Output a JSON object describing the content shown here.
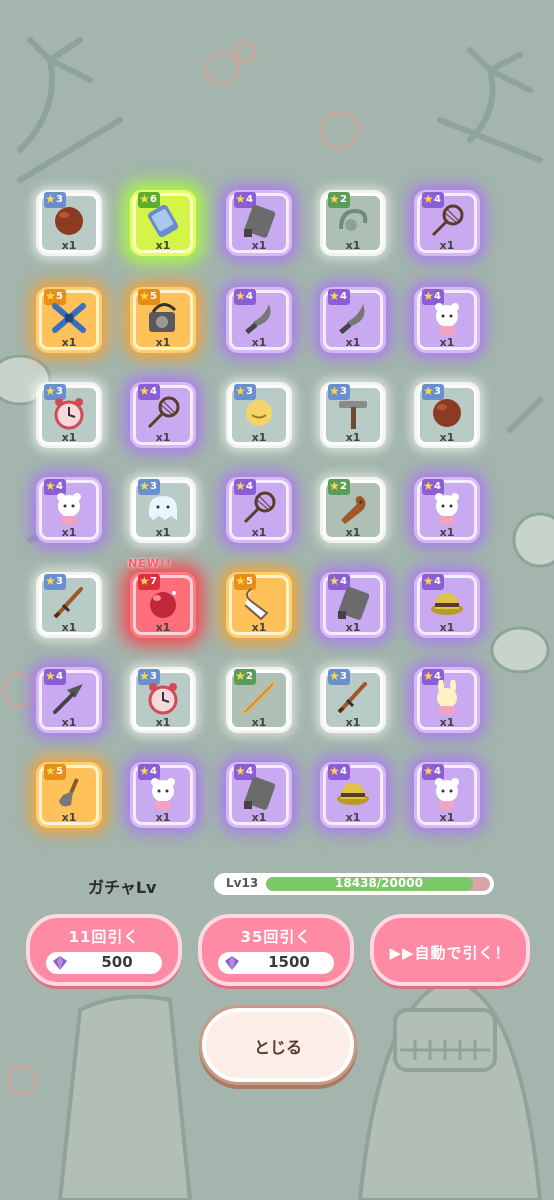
{
  "items": [
    {
      "stars": "3",
      "count": "x1",
      "rarity": "r3",
      "icon": "ball-icon"
    },
    {
      "stars": "6",
      "count": "x1",
      "rarity": "r6",
      "icon": "phone-icon"
    },
    {
      "stars": "4",
      "count": "x1",
      "rarity": "r4",
      "icon": "tablet-icon"
    },
    {
      "stars": "2",
      "count": "x1",
      "rarity": "r2",
      "icon": "hook-icon"
    },
    {
      "stars": "4",
      "count": "x1",
      "rarity": "r4",
      "icon": "net-icon"
    },
    {
      "stars": "5",
      "count": "x1",
      "rarity": "r5",
      "icon": "ninja-icon"
    },
    {
      "stars": "5",
      "count": "x1",
      "rarity": "r5",
      "icon": "camera-icon"
    },
    {
      "stars": "4",
      "count": "x1",
      "rarity": "r4",
      "icon": "knife-icon"
    },
    {
      "stars": "4",
      "count": "x1",
      "rarity": "r4",
      "icon": "knife-icon"
    },
    {
      "stars": "4",
      "count": "x1",
      "rarity": "r4",
      "icon": "bear-icon"
    },
    {
      "stars": "3",
      "count": "x1",
      "rarity": "r3",
      "icon": "clock-icon"
    },
    {
      "stars": "4",
      "count": "x1",
      "rarity": "r4",
      "icon": "net-icon"
    },
    {
      "stars": "3",
      "count": "x1",
      "rarity": "r3",
      "icon": "coin-icon"
    },
    {
      "stars": "3",
      "count": "x1",
      "rarity": "r3",
      "icon": "mop-icon"
    },
    {
      "stars": "3",
      "count": "x1",
      "rarity": "r3",
      "icon": "ball-icon"
    },
    {
      "stars": "4",
      "count": "x1",
      "rarity": "r4",
      "icon": "bear-icon"
    },
    {
      "stars": "3",
      "count": "x1",
      "rarity": "r3",
      "icon": "ghost-icon"
    },
    {
      "stars": "4",
      "count": "x1",
      "rarity": "r4",
      "icon": "net-icon"
    },
    {
      "stars": "2",
      "count": "x1",
      "rarity": "r2",
      "icon": "club-icon"
    },
    {
      "stars": "4",
      "count": "x1",
      "rarity": "r4",
      "icon": "bear-icon"
    },
    {
      "stars": "3",
      "count": "x1",
      "rarity": "r3",
      "icon": "sword-icon"
    },
    {
      "stars": "7",
      "count": "x1",
      "rarity": "r7",
      "icon": "gem-ball-icon",
      "badge": "NEW!!"
    },
    {
      "stars": "5",
      "count": "x1",
      "rarity": "r5",
      "icon": "scarf-icon"
    },
    {
      "stars": "4",
      "count": "x1",
      "rarity": "r4",
      "icon": "tablet-icon"
    },
    {
      "stars": "4",
      "count": "x1",
      "rarity": "r4",
      "icon": "hat-icon"
    },
    {
      "stars": "4",
      "count": "x1",
      "rarity": "r4",
      "icon": "arrow-icon"
    },
    {
      "stars": "3",
      "count": "x1",
      "rarity": "r3",
      "icon": "clock-icon"
    },
    {
      "stars": "2",
      "count": "x1",
      "rarity": "r2",
      "icon": "stick-icon"
    },
    {
      "stars": "3",
      "count": "x1",
      "rarity": "r3",
      "icon": "sword-icon"
    },
    {
      "stars": "4",
      "count": "x1",
      "rarity": "r4",
      "icon": "rabbit-icon"
    },
    {
      "stars": "5",
      "count": "x1",
      "rarity": "r5",
      "icon": "shovel-icon"
    },
    {
      "stars": "4",
      "count": "x1",
      "rarity": "r4",
      "icon": "bear-icon"
    },
    {
      "stars": "4",
      "count": "x1",
      "rarity": "r4",
      "icon": "tablet-icon"
    },
    {
      "stars": "4",
      "count": "x1",
      "rarity": "r4",
      "icon": "hat-icon"
    },
    {
      "stars": "4",
      "count": "x1",
      "rarity": "r4",
      "icon": "bear-icon"
    }
  ],
  "gacha": {
    "label": "ガチャLv",
    "level": "Lv13",
    "progress_text": "18438/20000",
    "progress_fraction": 0.9219
  },
  "buttons": {
    "draw11": {
      "label": "11回引く",
      "cost": "500"
    },
    "draw35": {
      "label": "35回引く",
      "cost": "1500"
    },
    "auto": {
      "label": "自動で引く！"
    },
    "close": {
      "label": "とじる"
    }
  },
  "colors": {
    "pink_button": "#ff8aa4",
    "progress_fill": "#7ac86a",
    "background": "#a3b5ac"
  }
}
